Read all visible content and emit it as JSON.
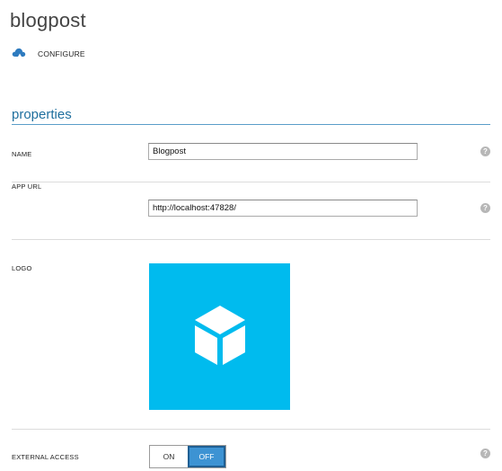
{
  "header": {
    "title": "blogpost"
  },
  "command_bar": {
    "configure_label": "CONFIGURE",
    "icon": "cloud-icon"
  },
  "section": {
    "title": "properties"
  },
  "fields": {
    "name": {
      "label": "NAME",
      "value": "Blogpost"
    },
    "app_url": {
      "label": "APP URL",
      "value": "http://localhost:47828/"
    },
    "logo": {
      "label": "LOGO",
      "icon": "cube-icon",
      "tile_color": "#00bbee"
    },
    "external_access": {
      "label": "EXTERNAL ACCESS",
      "on_label": "ON",
      "off_label": "OFF",
      "selected": "OFF"
    }
  },
  "help_glyph": "?",
  "colors": {
    "accent": "#1f6f9e",
    "toggle_selected": "#3d93d3",
    "logo_bg": "#00bbee"
  }
}
